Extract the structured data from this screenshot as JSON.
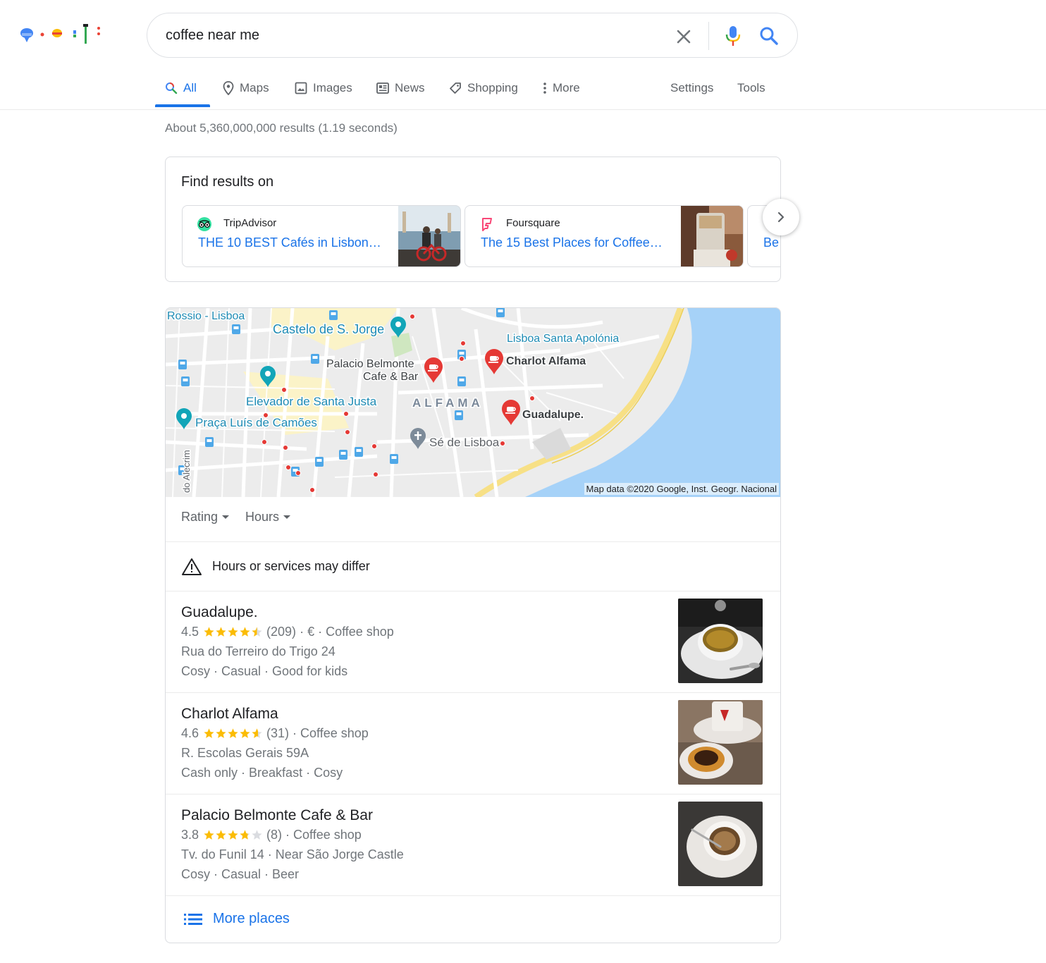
{
  "search": {
    "query": "coffee near me"
  },
  "nav": {
    "tabs": [
      {
        "label": "All",
        "icon": "search-icon",
        "active": true
      },
      {
        "label": "Maps",
        "icon": "map-pin-icon"
      },
      {
        "label": "Images",
        "icon": "image-icon"
      },
      {
        "label": "News",
        "icon": "news-icon"
      },
      {
        "label": "Shopping",
        "icon": "tag-icon"
      },
      {
        "label": "More",
        "icon": "more-vert-icon"
      }
    ],
    "settings": "Settings",
    "tools": "Tools"
  },
  "results_count": "About 5,360,000,000 results (1.19 seconds)",
  "find_results": {
    "title": "Find results on",
    "sources": [
      {
        "name": "TripAdvisor",
        "link": "THE 10 BEST Cafés in Lisbon…",
        "icon": "tripadvisor-icon"
      },
      {
        "name": "Foursquare",
        "link": "The 15 Best Places for Coffee…",
        "icon": "foursquare-icon"
      },
      {
        "name": "",
        "link": "Be"
      }
    ]
  },
  "map": {
    "labels": {
      "rossio": "Rossio - Lisboa",
      "castelo": "Castelo de S. Jorge",
      "santa_apolonia": "Lisboa Santa Apolónia",
      "palacio_1": "Palacio Belmonte",
      "palacio_2": "Cafe & Bar",
      "charlot": "Charlot Alfama",
      "elevador": "Elevador de Santa Justa",
      "alfama": "ALFAMA",
      "guadalupe": "Guadalupe.",
      "praca": "Praça Luís de Camões",
      "se": "Sé de Lisboa",
      "alecrim": "do Alecrim"
    },
    "attribution": "Map data ©2020 Google, Inst. Geogr. Nacional",
    "colors": {
      "water": "#a6d2f8",
      "land": "#ececec",
      "highway": "#f7e086",
      "pin": "#e53935"
    }
  },
  "filters": {
    "rating": "Rating",
    "hours": "Hours"
  },
  "notice": "Hours or services may differ",
  "places": [
    {
      "name": "Guadalupe.",
      "rating": "4.5",
      "rating_value": 4.5,
      "reviews": "(209)",
      "price": "€",
      "category": "Coffee shop",
      "address": "Rua do Terreiro do Trigo 24",
      "tags": "Cosy · Casual · Good for kids"
    },
    {
      "name": "Charlot Alfama",
      "rating": "4.6",
      "rating_value": 4.6,
      "reviews": "(31)",
      "category": "Coffee shop",
      "address": "R. Escolas Gerais 59A",
      "tags": "Cash only · Breakfast · Cosy"
    },
    {
      "name": "Palacio Belmonte Cafe & Bar",
      "rating": "3.8",
      "rating_value": 3.8,
      "reviews": "(8)",
      "category": "Coffee shop",
      "address": "Tv. do Funil 14 · Near São Jorge Castle",
      "tags": "Cosy · Casual · Beer"
    }
  ],
  "more_places": "More places"
}
